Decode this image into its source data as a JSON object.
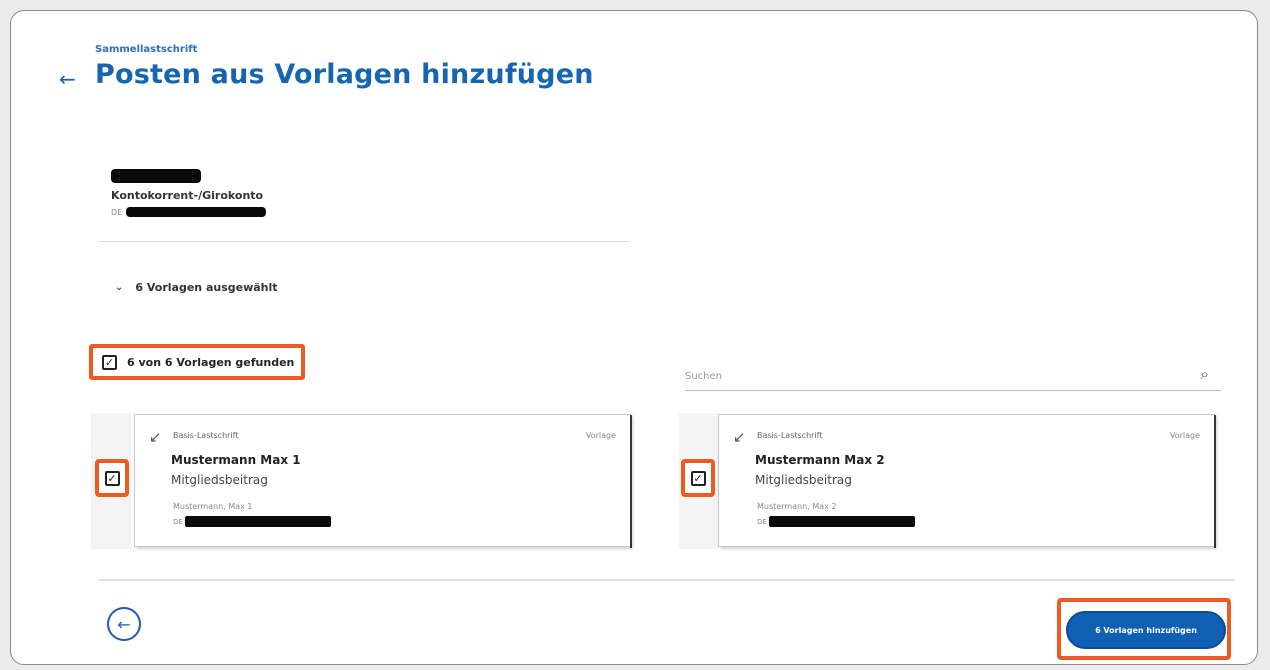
{
  "header": {
    "breadcrumb": "Sammellastschrift",
    "title": "Posten aus Vorlagen hinzufügen",
    "back_glyph": "←"
  },
  "account": {
    "type": "Kontokorrent-/Girokonto",
    "iban_prefix": "DE"
  },
  "selection": {
    "toggle_label": "6 Vorlagen ausgewählt",
    "found_label": "6 von 6 Vorlagen gefunden",
    "all_checked": true
  },
  "search": {
    "placeholder": "Suchen"
  },
  "templates": [
    {
      "type": "Basis-Lastschrift",
      "badge": "Vorlage",
      "name": "Mustermann Max 1",
      "description": "Mitgliedsbeitrag",
      "holder": "Mustermann, Max 1",
      "iban_prefix": "DE",
      "checked": true
    },
    {
      "type": "Basis-Lastschrift",
      "badge": "Vorlage",
      "name": "Mustermann Max 2",
      "description": "Mitgliedsbeitrag",
      "holder": "Mustermann, Max 2",
      "iban_prefix": "DE",
      "checked": true
    }
  ],
  "footer": {
    "back_glyph": "←",
    "submit_label": "6 Vorlagen hinzufügen"
  },
  "colors": {
    "primary": "#1565b0",
    "highlight": "#ee5b22",
    "button": "#0f5fb4"
  },
  "icons": {
    "checkmark": "✓",
    "search": "⌕",
    "chevron": "⌄",
    "direct_debit_arrow": "↙"
  }
}
